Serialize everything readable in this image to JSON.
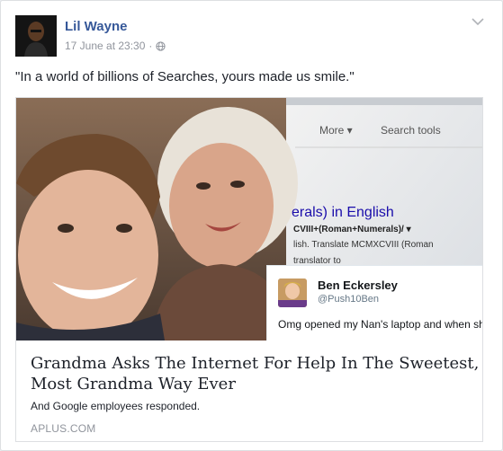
{
  "post": {
    "author": "Lil Wayne",
    "timestamp": "17 June at 23:30",
    "separator": "·",
    "audience_icon": "globe-icon",
    "menu_icon": "chevron-down-icon",
    "text": "\"In a world of billions of Searches, yours made us smile.\""
  },
  "link": {
    "title": "Grandma Asks The Internet For Help In The Sweetest, Most Grandma Way Ever",
    "description": "And Google employees responded.",
    "domain": "APLUS.COM"
  },
  "image": {
    "toolbar_more": "More ▾",
    "toolbar_search_tools": "Search tools",
    "translate_heading": "erals) in English",
    "translate_query": "CVIII+(Roman+Numerals)/ ▾",
    "translate_snippet": "lish. Translate MCMXCVIII (Roman",
    "translate_snippet2": "translator to",
    "tweet_name": "Ben Eckersley",
    "tweet_handle": "@Push10Ben",
    "tweet_text": "Omg opened my Nan's laptop and when she's googled so"
  },
  "colors": {
    "author_link": "#365899",
    "meta_gray": "#90949c",
    "text": "#1d2129",
    "border": "#dddfe2"
  }
}
